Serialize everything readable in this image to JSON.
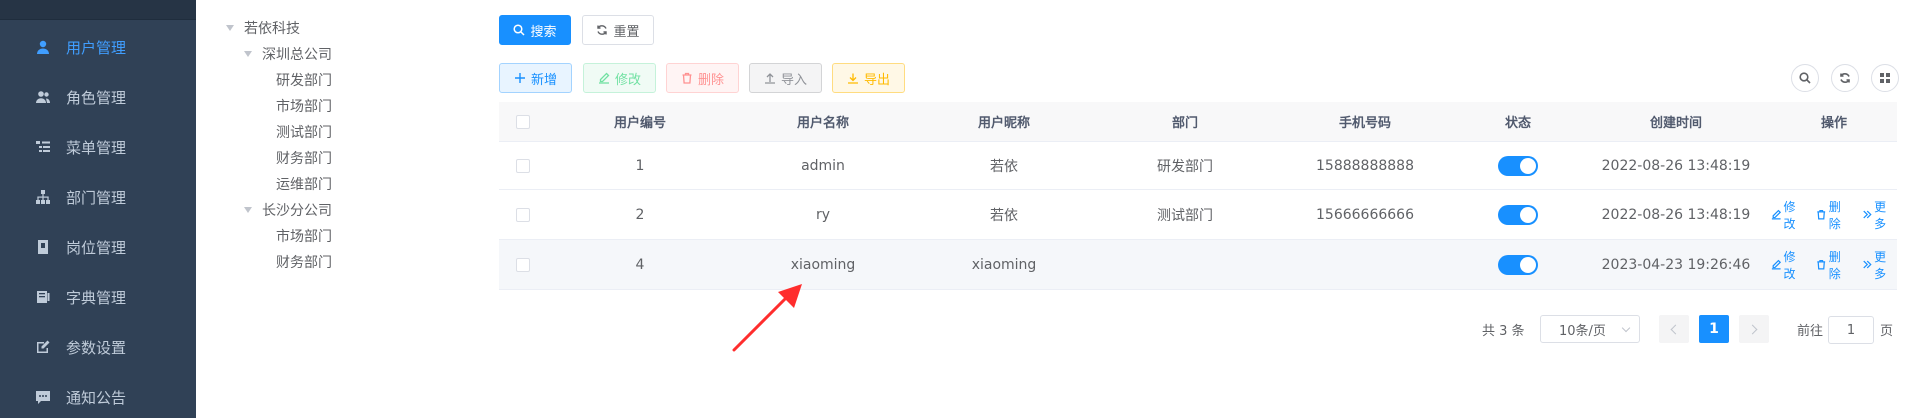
{
  "sidebar": {
    "items": [
      {
        "label": "用户管理",
        "icon": "user-icon",
        "active": true
      },
      {
        "label": "角色管理",
        "icon": "peoples-icon",
        "active": false
      },
      {
        "label": "菜单管理",
        "icon": "tree-table-icon",
        "active": false
      },
      {
        "label": "部门管理",
        "icon": "tree-icon",
        "active": false
      },
      {
        "label": "岗位管理",
        "icon": "post-icon",
        "active": false
      },
      {
        "label": "字典管理",
        "icon": "dict-icon",
        "active": false
      },
      {
        "label": "参数设置",
        "icon": "edit-icon",
        "active": false
      },
      {
        "label": "通知公告",
        "icon": "message-icon",
        "active": false
      }
    ]
  },
  "tree": {
    "root": "若依科技",
    "branch1": "深圳总公司",
    "branch1_children": [
      "研发部门",
      "市场部门",
      "测试部门",
      "财务部门",
      "运维部门"
    ],
    "branch2": "长沙分公司",
    "branch2_children": [
      "市场部门",
      "财务部门"
    ]
  },
  "search": {
    "search_label": "搜索",
    "reset_label": "重置"
  },
  "toolbar": {
    "add_label": "新增",
    "edit_label": "修改",
    "delete_label": "删除",
    "import_label": "导入",
    "export_label": "导出"
  },
  "table": {
    "headers": [
      "用户编号",
      "用户名称",
      "用户昵称",
      "部门",
      "手机号码",
      "状态",
      "创建时间",
      "操作"
    ],
    "rows": [
      {
        "id": "1",
        "username": "admin",
        "nickname": "若依",
        "dept": "研发部门",
        "phone": "15888888888",
        "status_on": true,
        "created": "2022-08-26 13:48:19",
        "actions": []
      },
      {
        "id": "2",
        "username": "ry",
        "nickname": "若依",
        "dept": "测试部门",
        "phone": "15666666666",
        "status_on": true,
        "created": "2022-08-26 13:48:19",
        "actions": [
          "修改",
          "删除",
          "更多"
        ]
      },
      {
        "id": "4",
        "username": "xiaoming",
        "nickname": "xiaoming",
        "dept": "",
        "phone": "",
        "status_on": true,
        "created": "2023-04-23 19:26:46",
        "actions": [
          "修改",
          "删除",
          "更多"
        ]
      }
    ]
  },
  "pagination": {
    "total_text": "共 3 条",
    "page_size": "10条/页",
    "current_page": "1",
    "goto_prefix": "前往",
    "goto_value": "1",
    "goto_suffix": "页"
  },
  "colors": {
    "primary": "#1890ff",
    "sidebar_bg": "#304156",
    "annotation_arrow": "#ff2d2d"
  }
}
